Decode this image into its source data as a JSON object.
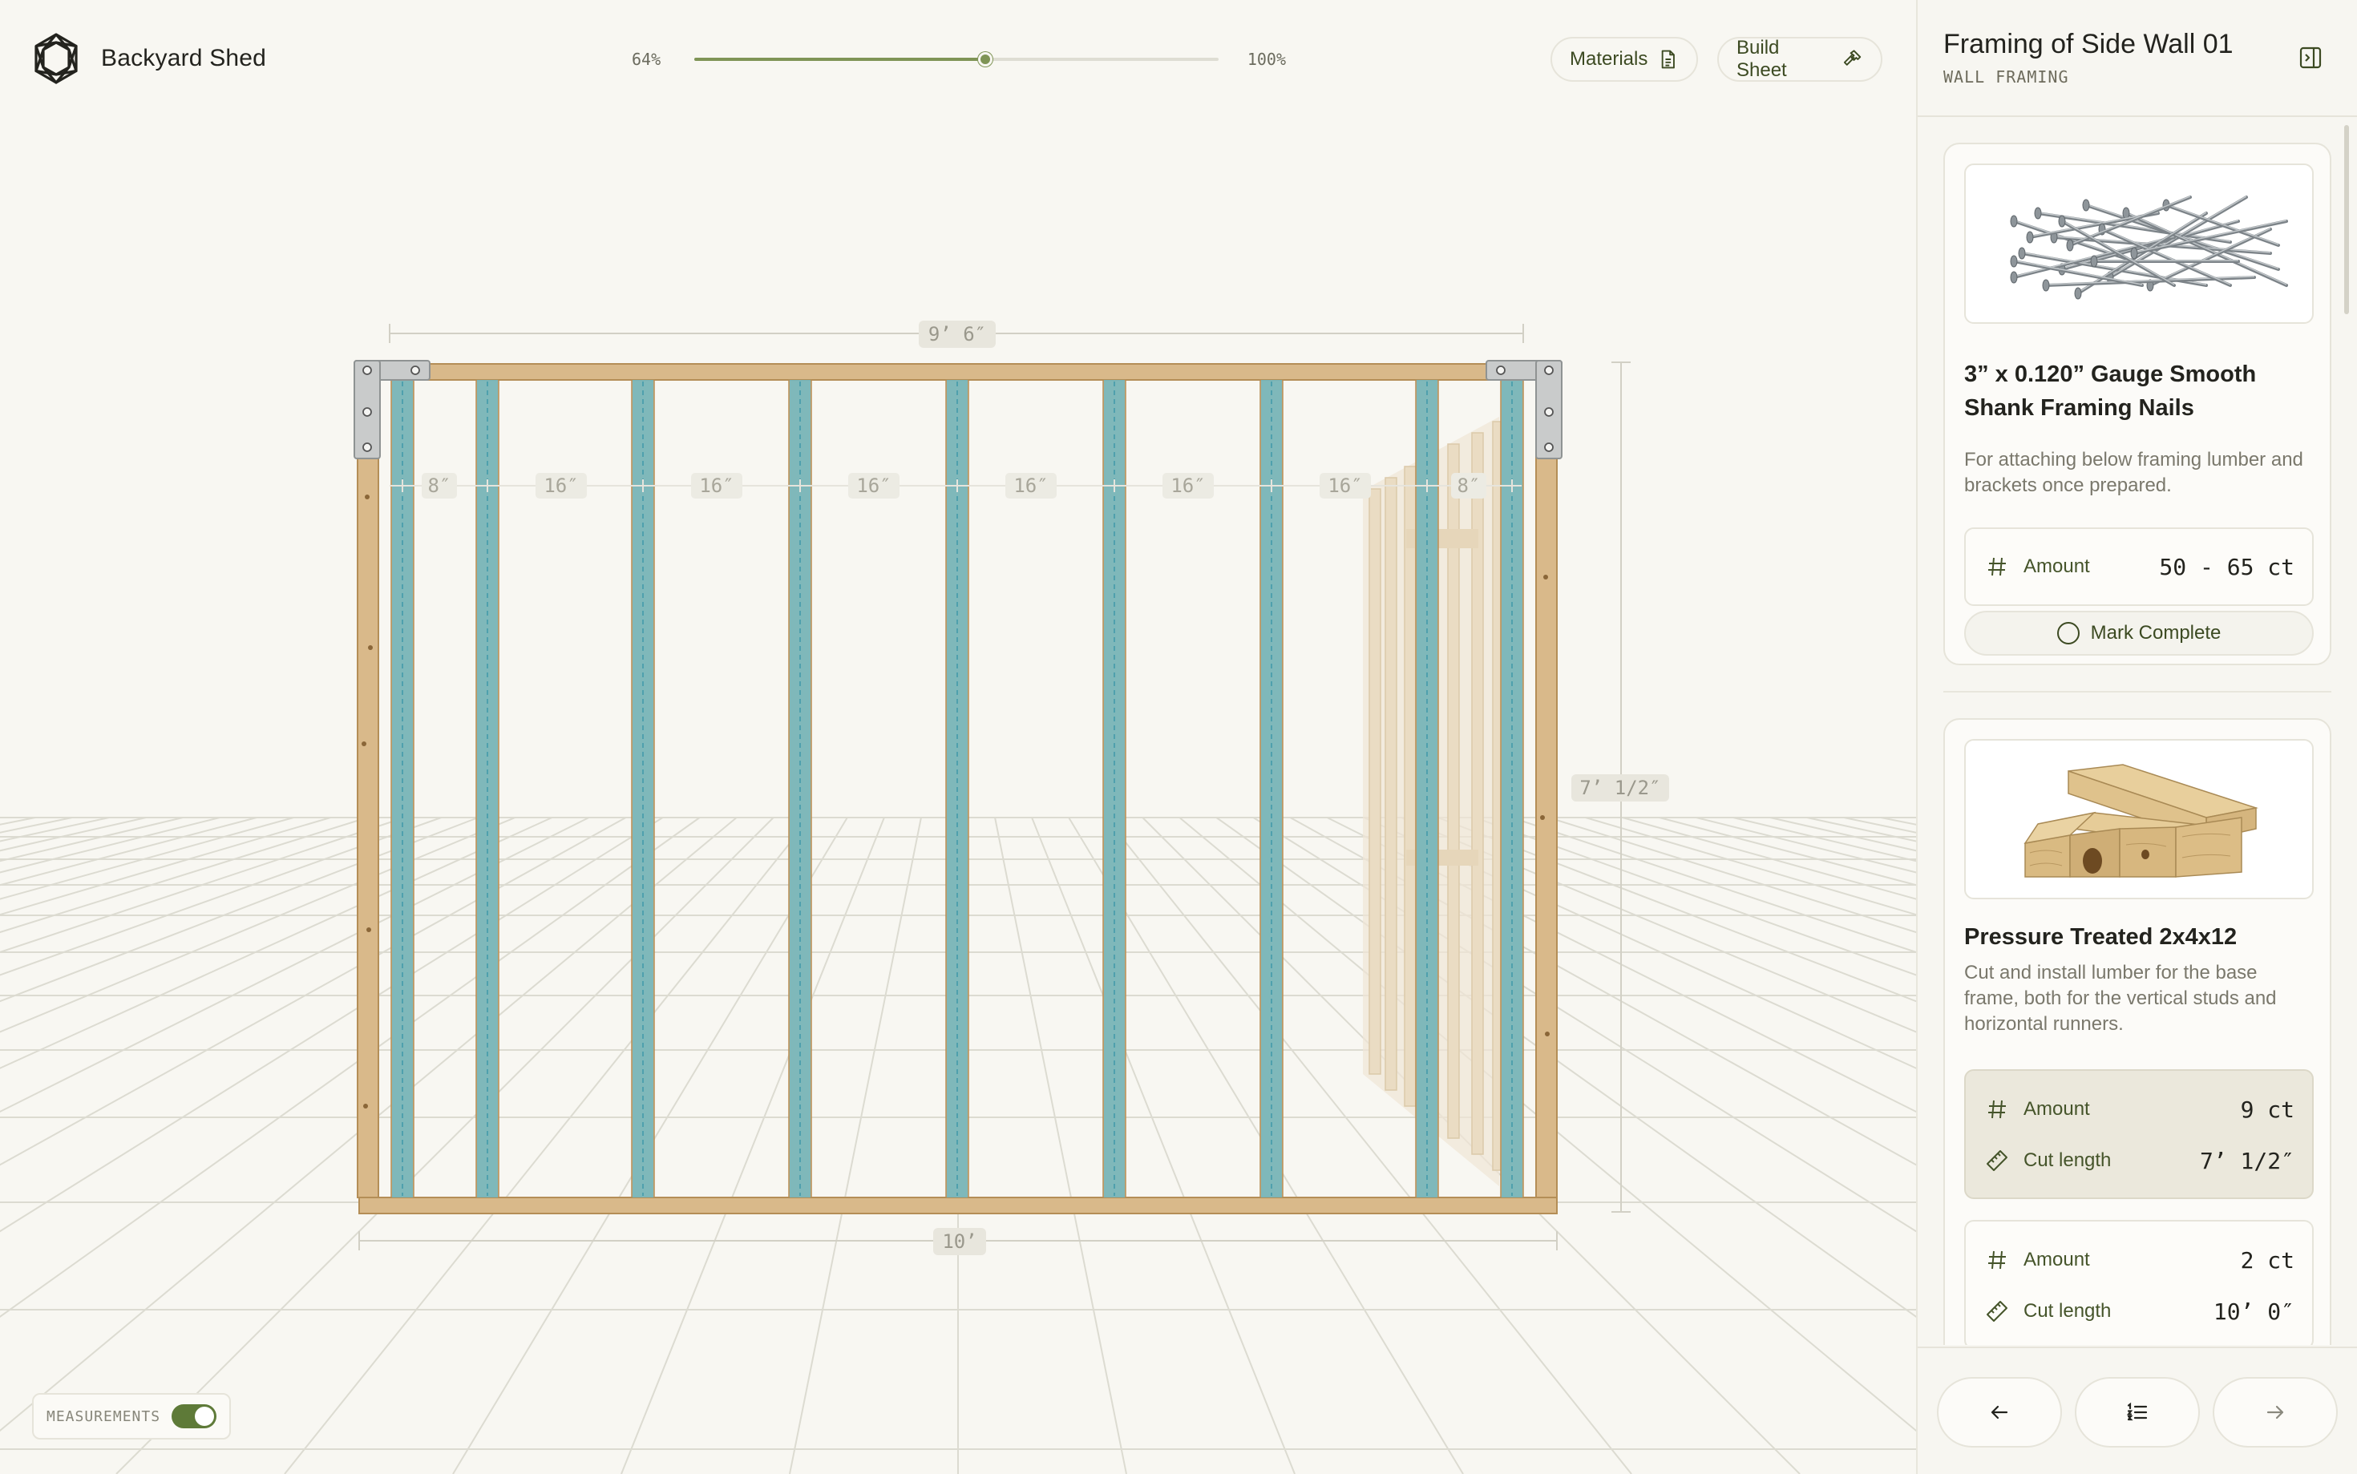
{
  "app": {
    "title": "Backyard Shed",
    "logo_icon": "geodesic-logo-icon"
  },
  "zoom": {
    "min_label": "64%",
    "max_label": "100%",
    "value_fraction": 0.555
  },
  "header": {
    "materials_label": "Materials",
    "materials_icon": "document-icon",
    "build_sheet_label": "Build Sheet",
    "build_sheet_icon": "hammer-icon"
  },
  "drawing": {
    "top_width": "9’ 6″",
    "bottom_width": "10’",
    "height": "7’ 1/2″",
    "spacings": [
      "8″",
      "16″",
      "16″",
      "16″",
      "16″",
      "16″",
      "16″",
      "8″"
    ],
    "stud_highlight_color": "#6fb7c2",
    "lumber_color": "#d9b98a"
  },
  "measurements": {
    "label": "MEASUREMENTS",
    "enabled": true
  },
  "panel": {
    "title": "Framing of Side Wall 01",
    "subtitle": "WALL FRAMING",
    "collapse_icon": "sidebar-collapse-icon",
    "materials": [
      {
        "name": "3” x 0.120” Gauge Smooth Shank Framing Nails",
        "description": "For attaching below framing lumber and brackets once prepared.",
        "image_icon": "nails-pile-image",
        "groups": [
          {
            "rows": [
              {
                "icon": "hash-icon",
                "label": "Amount",
                "value": "50 - 65 ct"
              }
            ]
          }
        ],
        "action_label": "Mark Complete"
      },
      {
        "name": "Pressure Treated 2x4x12",
        "description": "Cut and install lumber for the base frame, both for the vertical studs and horizontal runners.",
        "image_icon": "lumber-stack-image",
        "groups": [
          {
            "active": true,
            "rows": [
              {
                "icon": "hash-icon",
                "label": "Amount",
                "value": "9 ct"
              },
              {
                "icon": "ruler-icon",
                "label": "Cut length",
                "value": "7’ 1/2″"
              }
            ]
          },
          {
            "active": false,
            "rows": [
              {
                "icon": "hash-icon",
                "label": "Amount",
                "value": "2 ct"
              },
              {
                "icon": "ruler-icon",
                "label": "Cut length",
                "value": "10’ 0″"
              }
            ]
          }
        ]
      }
    ],
    "footer": {
      "prev_icon": "arrow-left-icon",
      "list_icon": "list-icon",
      "next_icon": "arrow-right-icon"
    }
  }
}
